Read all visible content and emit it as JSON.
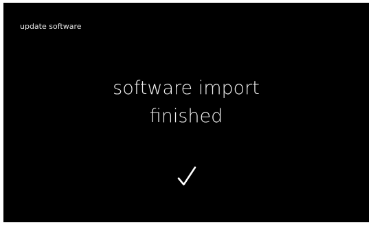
{
  "header": {
    "title": "update software"
  },
  "message": {
    "line1": "software import",
    "line2": "finished"
  },
  "status": {
    "icon": "checkmark-icon"
  },
  "colors": {
    "background": "#000000",
    "text": "#ffffff"
  }
}
